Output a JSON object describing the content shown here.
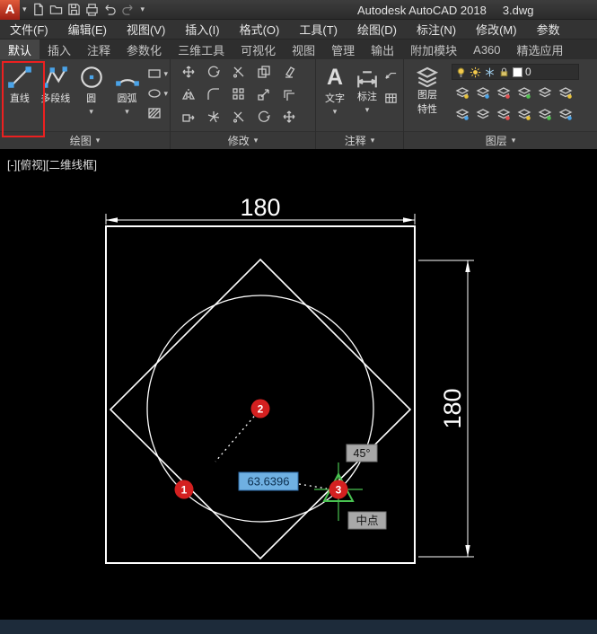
{
  "glyphs": {
    "caret": "▾",
    "text_tool": "A",
    "app_logo": "A"
  },
  "titlebar": {
    "app_title": "Autodesk AutoCAD 2018",
    "filename": "3.dwg"
  },
  "menubar": {
    "items": [
      "文件(F)",
      "编辑(E)",
      "视图(V)",
      "插入(I)",
      "格式(O)",
      "工具(T)",
      "绘图(D)",
      "标注(N)",
      "修改(M)",
      "参数"
    ]
  },
  "ribbon": {
    "tabs": [
      "默认",
      "插入",
      "注释",
      "参数化",
      "三维工具",
      "可视化",
      "视图",
      "管理",
      "输出",
      "附加模块",
      "A360",
      "精选应用"
    ],
    "active_tab": "默认",
    "panels": {
      "draw": {
        "label": "绘图",
        "line": "直线",
        "polyline": "多段线",
        "circle": "圆",
        "arc": "圆弧"
      },
      "modify": {
        "label": "修改"
      },
      "annotate": {
        "label": "注释",
        "text": "文字",
        "dimension": "标注"
      },
      "layer": {
        "label": "图层",
        "properties_line1": "图层",
        "properties_line2": "特性",
        "current_layer": "0"
      }
    }
  },
  "viewport": {
    "label": "[-][俯视][二维线框]"
  },
  "canvas": {
    "dim_top": "180",
    "dim_right": "180",
    "marker1": "1",
    "marker2": "2",
    "marker3": "3",
    "dynamic_input": "63.6396",
    "angle_tooltip": "45°",
    "osnap_tooltip": "中点"
  },
  "colors": {
    "marker-red": "#d42020",
    "snap-green": "#49c351",
    "node-blue": "#4aa3e8",
    "dyn-input-blue": "#6fb0e2",
    "highlight-red": "#ec2020",
    "tooltip-gray": "#a8a8a8",
    "statusbar-bg": "#1d2b3a"
  }
}
